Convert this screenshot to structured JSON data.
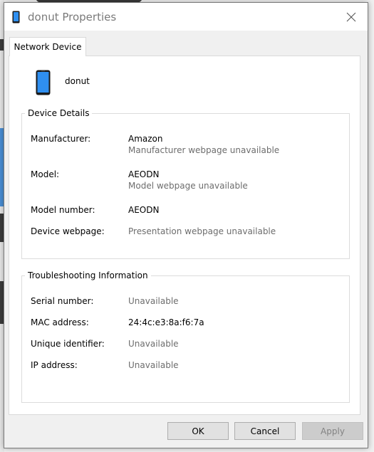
{
  "window": {
    "title": "donut Properties"
  },
  "tabs": [
    {
      "label": "Network Device",
      "active": true
    }
  ],
  "device": {
    "name": "donut",
    "icon": "phone-icon"
  },
  "device_details": {
    "title": "Device Details",
    "rows": [
      {
        "label": "Manufacturer:",
        "value": "Amazon",
        "sub": "Manufacturer webpage unavailable"
      },
      {
        "label": "Model:",
        "value": "AEODN",
        "sub": "Model webpage unavailable"
      },
      {
        "label": "Model number:",
        "value": "AEODN"
      },
      {
        "label": "Device webpage:",
        "value": "Presentation webpage unavailable"
      }
    ]
  },
  "troubleshooting": {
    "title": "Troubleshooting Information",
    "rows": [
      {
        "label": "Serial number:",
        "value": "Unavailable"
      },
      {
        "label": "MAC address:",
        "value": "24:4c:e3:8a:f6:7a"
      },
      {
        "label": "Unique identifier:",
        "value": "Unavailable"
      },
      {
        "label": "IP address:",
        "value": "Unavailable"
      }
    ]
  },
  "buttons": {
    "ok": "OK",
    "cancel": "Cancel",
    "apply": "Apply"
  },
  "colors": {
    "muted_text": "#6d6d6d",
    "icon_blue": "#1e90ff"
  }
}
